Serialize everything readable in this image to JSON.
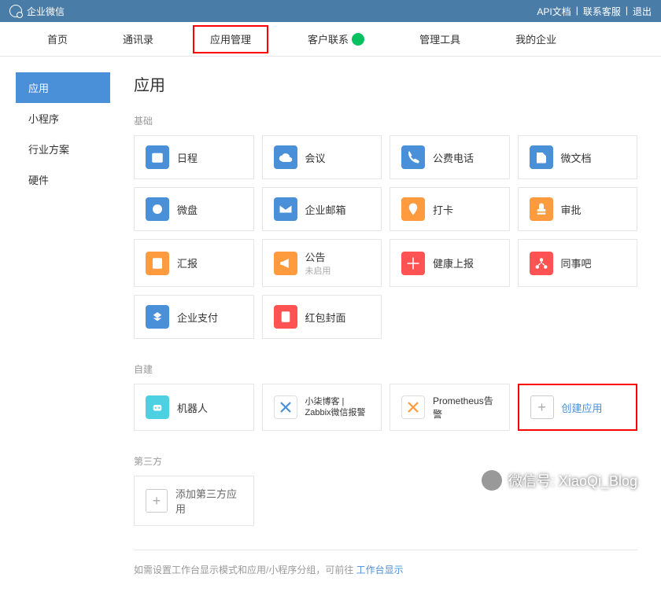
{
  "header": {
    "brand": "企业微信",
    "links": {
      "api": "API文档",
      "contact": "联系客服",
      "logout": "退出"
    }
  },
  "nav": {
    "home": "首页",
    "contacts": "通讯录",
    "apps": "应用管理",
    "customer": "客户联系",
    "tools": "管理工具",
    "company": "我的企业"
  },
  "sidebar": {
    "app": "应用",
    "miniprogram": "小程序",
    "industry": "行业方案",
    "hardware": "硬件"
  },
  "page": {
    "title": "应用"
  },
  "sections": {
    "basic": {
      "label": "基础"
    },
    "selfbuilt": {
      "label": "自建"
    },
    "thirdparty": {
      "label": "第三方"
    }
  },
  "apps": {
    "calendar": "日程",
    "meeting": "会议",
    "phone": "公费电话",
    "doc": "微文档",
    "disk": "微盘",
    "mail": "企业邮箱",
    "checkin": "打卡",
    "approval": "审批",
    "report": "汇报",
    "announce": "公告",
    "announce_sub": "未启用",
    "health": "健康上报",
    "colleague": "同事吧",
    "pay": "企业支付",
    "redpack": "红包封面",
    "robot": "机器人",
    "zabbix": "小柒博客 | Zabbix微信报警",
    "prometheus": "Prometheus告警",
    "create": "创建应用",
    "add_thirdparty": "添加第三方应用"
  },
  "footer": {
    "text": "如需设置工作台显示模式和应用/小程序分组，可前往 ",
    "link": "工作台显示"
  },
  "watermark": {
    "prefix": "微信号:",
    "id": "XiaoQi_Blog"
  }
}
